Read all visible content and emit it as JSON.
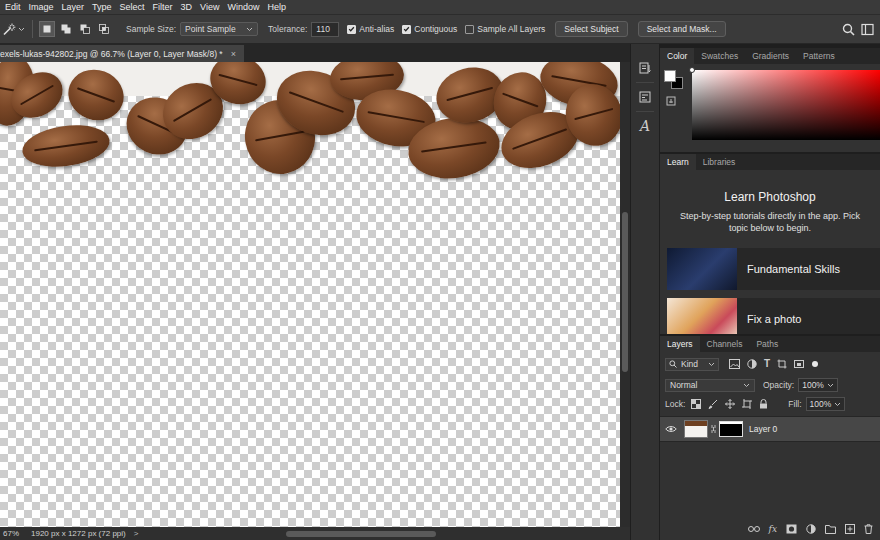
{
  "menu_bar": {
    "items": [
      "Edit",
      "Image",
      "Layer",
      "Type",
      "Select",
      "Filter",
      "3D",
      "View",
      "Window",
      "Help"
    ]
  },
  "options_bar": {
    "selection_modes": [
      {
        "kind": "new",
        "selected": true
      },
      {
        "kind": "add",
        "selected": false
      },
      {
        "kind": "subtract",
        "selected": false
      },
      {
        "kind": "intersect",
        "selected": false
      }
    ],
    "sample_size": {
      "label": "Sample Size:",
      "value": "Point Sample"
    },
    "tolerance": {
      "label": "Tolerance:",
      "value": "110"
    },
    "checkboxes": [
      {
        "label": "Anti-alias",
        "checked": true
      },
      {
        "label": "Contiguous",
        "checked": true
      },
      {
        "label": "Sample All Layers",
        "checked": false
      }
    ],
    "buttons": [
      "Select Subject",
      "Select and Mask..."
    ]
  },
  "document": {
    "tab_title": "exels-lukas-942802.jpg @ 66.7% (Layer 0, Layer Mask/8) *",
    "close_glyph": "×"
  },
  "status_bar": {
    "zoom": "67%",
    "info": "1920 px x 1272 px (72 ppi)",
    "arrow": ">"
  },
  "side_strip": {
    "glyphs_icon": "A"
  },
  "color_panel": {
    "tabs": [
      {
        "label": "Color",
        "selected": true
      },
      {
        "label": "Swatches",
        "selected": false
      },
      {
        "label": "Gradients",
        "selected": false
      },
      {
        "label": "Patterns",
        "selected": false
      }
    ],
    "foreground_color": "#ffffff",
    "background_color": "#000000",
    "hue": "#ff0000"
  },
  "learn_panel": {
    "tabs": [
      {
        "label": "Learn",
        "selected": true
      },
      {
        "label": "Libraries",
        "selected": false
      }
    ],
    "title": "Learn Photoshop",
    "description_lines": [
      "Step-by-step tutorials directly in the app. Pick",
      "topic below to begin."
    ],
    "cards": [
      "Fundamental Skills",
      "Fix a photo"
    ]
  },
  "layers_panel": {
    "tabs": [
      {
        "label": "Layers",
        "selected": true
      },
      {
        "label": "Channels",
        "selected": false
      },
      {
        "label": "Paths",
        "selected": false
      }
    ],
    "filter": "Kind",
    "filter_type_glyph": "T",
    "blend_mode": "Normal",
    "opacity": {
      "label": "Opacity:",
      "value": "100%"
    },
    "lock_label": "Lock:",
    "fill": {
      "label": "Fill:",
      "value": "100%"
    },
    "layers": [
      {
        "name": "Layer 0",
        "visible": true,
        "selected": true,
        "has_mask": true
      }
    ],
    "fx_label": "fx"
  }
}
